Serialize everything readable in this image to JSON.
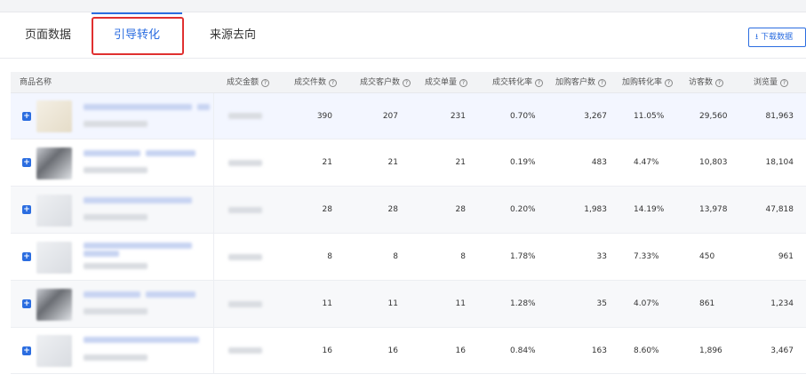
{
  "tabs": [
    {
      "label": "页面数据"
    },
    {
      "label": "引导转化"
    },
    {
      "label": "来源去向"
    }
  ],
  "download": {
    "label": "下载数据",
    "icon": "download-icon"
  },
  "table": {
    "columns": [
      {
        "label": "商品名称"
      },
      {
        "label": "成交金额"
      },
      {
        "label": "成交件数"
      },
      {
        "label": "成交客户数"
      },
      {
        "label": "成交单量"
      },
      {
        "label": "成交转化率"
      },
      {
        "label": "加购客户数"
      },
      {
        "label": "加购转化率"
      },
      {
        "label": "访客数"
      },
      {
        "label": "浏览量"
      }
    ],
    "help_icon": "?",
    "expand_icon": "+",
    "rows": [
      {
        "items": "390",
        "customers": "207",
        "orders": "231",
        "conv": "0.70%",
        "cart_customers": "3,267",
        "cart_conv": "11.05%",
        "visitors": "29,560",
        "views": "81,963"
      },
      {
        "items": "21",
        "customers": "21",
        "orders": "21",
        "conv": "0.19%",
        "cart_customers": "483",
        "cart_conv": "4.47%",
        "visitors": "10,803",
        "views": "18,104"
      },
      {
        "items": "28",
        "customers": "28",
        "orders": "28",
        "conv": "0.20%",
        "cart_customers": "1,983",
        "cart_conv": "14.19%",
        "visitors": "13,978",
        "views": "47,818"
      },
      {
        "items": "8",
        "customers": "8",
        "orders": "8",
        "conv": "1.78%",
        "cart_customers": "33",
        "cart_conv": "7.33%",
        "visitors": "450",
        "views": "961"
      },
      {
        "items": "11",
        "customers": "11",
        "orders": "11",
        "conv": "1.28%",
        "cart_customers": "35",
        "cart_conv": "4.07%",
        "visitors": "861",
        "views": "1,234"
      },
      {
        "items": "16",
        "customers": "16",
        "orders": "16",
        "conv": "0.84%",
        "cart_customers": "163",
        "cart_conv": "8.60%",
        "visitors": "1,896",
        "views": "3,467"
      }
    ]
  }
}
